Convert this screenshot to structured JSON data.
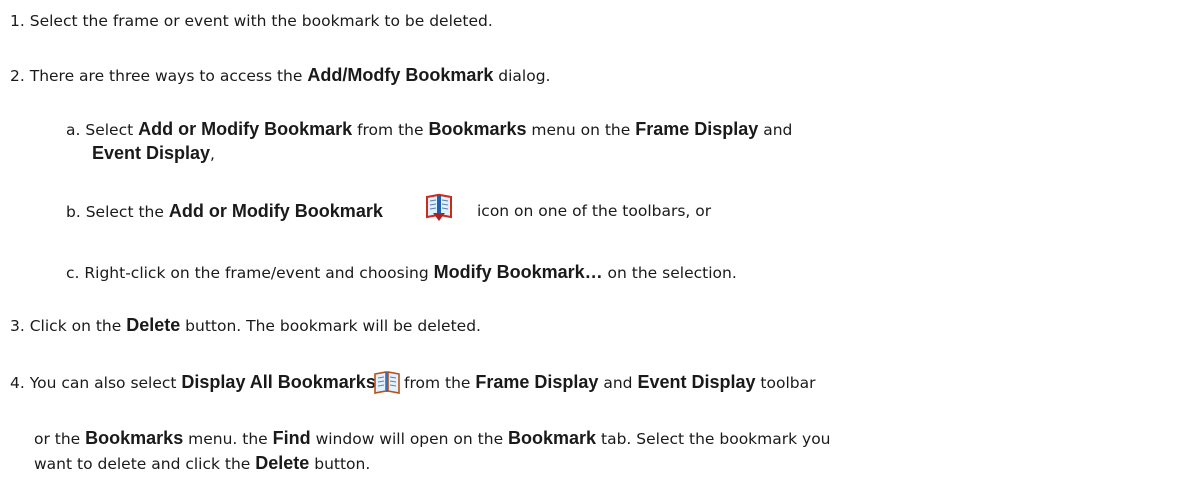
{
  "steps": {
    "s1": {
      "num": "1.",
      "text": "Select the frame or event with the bookmark to be deleted."
    },
    "s2": {
      "num": "2.",
      "pre": "There are three ways to access the ",
      "dialog": "Add/Modfy Bookmark",
      "post": " dialog."
    },
    "a": {
      "letter": "a.",
      "t1": "Select ",
      "b1": "Add or Modify Bookmark",
      "t2": " from the ",
      "b2": "Bookmarks",
      "t3": " menu on the ",
      "b3": "Frame Display",
      "t4": " and",
      "b4": "Event Display",
      "t5": ","
    },
    "b": {
      "letter": "b.",
      "t1": "Select the ",
      "b1": "Add or Modify Bookmark",
      "t2": "icon on one of the toolbars, or"
    },
    "c": {
      "letter": "c.",
      "t1": "Right-click on the frame/event and choosing ",
      "b1": "Modify Bookmark…",
      "t2": " on the selection."
    },
    "s3": {
      "num": "3.",
      "t1": "Click on the ",
      "b1": "Delete",
      "t2": " button. The bookmark will be deleted."
    },
    "s4": {
      "num": "4.",
      "t1": "You can also select ",
      "b1": "Display All Bookmarks",
      "t2": " from the ",
      "b2": "Frame Display",
      "t3": " and ",
      "b3": "Event Display",
      "t4": " toolbar",
      "l2t1": "or the ",
      "l2b1": "Bookmarks",
      "l2t2": " menu. the ",
      "l2b2": "Find",
      "l2t3": " window will open on the ",
      "l2b3": "Bookmark",
      "l2t4": " tab. Select the bookmark you",
      "l3t1": "want to delete and click the ",
      "l3b1": "Delete",
      "l3t2": " button."
    }
  },
  "icons": {
    "add_modify": "bookmark-book-arrow-icon",
    "display_all": "bookmark-book-icon"
  }
}
